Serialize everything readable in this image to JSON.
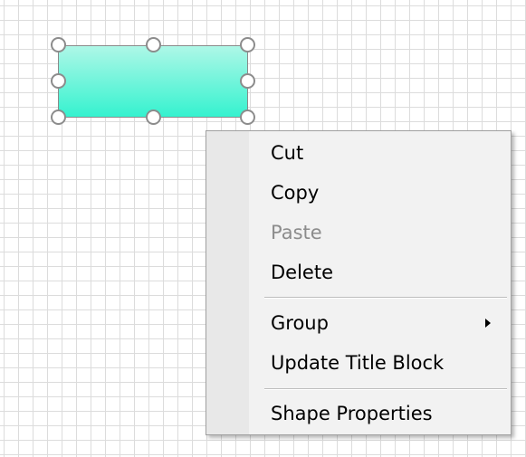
{
  "colors": {
    "shape_fill_top": "#aef7e7",
    "shape_fill_bottom": "#35f2cf",
    "grid_line": "#dcdcdc",
    "menu_background": "#f2f2f2",
    "disabled_text": "#8c8c8c"
  },
  "context_menu": {
    "cut_label": "Cut",
    "copy_label": "Copy",
    "paste_label": "Paste",
    "delete_label": "Delete",
    "group_label": "Group",
    "update_title_block_label": "Update Title Block",
    "shape_properties_label": "Shape Properties",
    "paste_enabled": false,
    "group_has_submenu": true
  }
}
